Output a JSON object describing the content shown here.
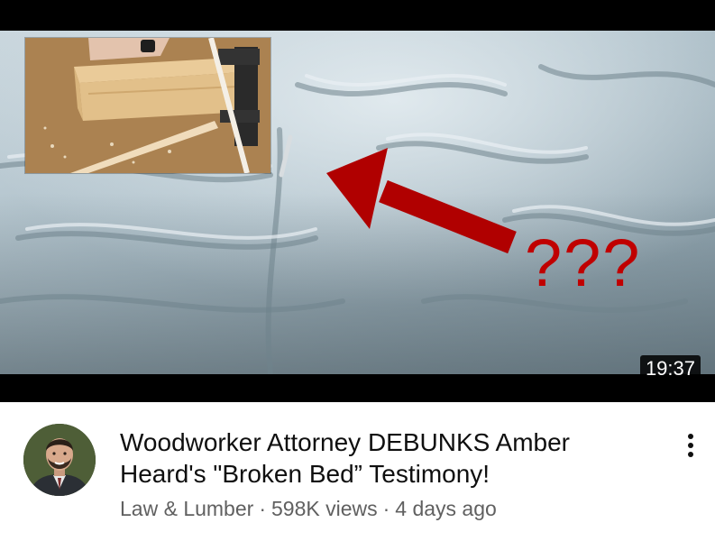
{
  "video": {
    "thumbnail": {
      "overlay_text": "???",
      "overlay_color": "#c00000",
      "arrow_color": "#b00000",
      "icon": "red-arrow-icon"
    },
    "duration": "19:37",
    "title": "Woodworker Attorney DEBUNKS Amber Heard's \"Broken Bed” Testimony!",
    "channel": "Law & Lumber",
    "separator": "·",
    "views": "598K views",
    "age": "4 days ago",
    "menu_icon": "more-vert-icon"
  },
  "colors": {
    "title": "#0f0f0f",
    "meta": "#606060",
    "duration_bg": "#000000"
  }
}
